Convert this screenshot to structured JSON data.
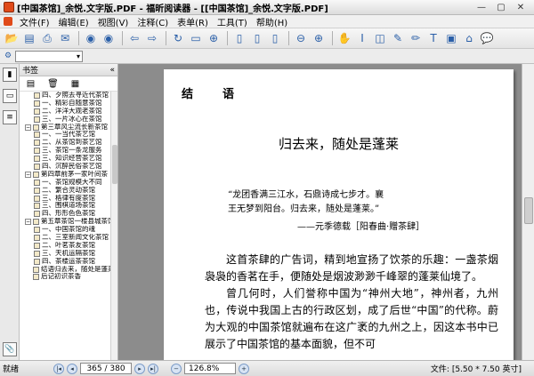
{
  "window": {
    "title": "[中国茶馆]_余悦.文字版.PDF - 福昕阅读器 - [[中国茶馆]_余悦.文字版.PDF]",
    "controls": [
      "minimize-icon",
      "maximize-icon",
      "close-icon"
    ]
  },
  "menu": {
    "items": [
      "文件(F)",
      "编辑(E)",
      "视图(V)",
      "注释(C)",
      "表单(R)",
      "工具(T)",
      "帮助(H)"
    ]
  },
  "toolbar": {
    "icons": [
      "open-icon",
      "save-icon",
      "print-icon",
      "email-icon",
      "nav-back-icon",
      "nav-forward-icon",
      "prev-view-icon",
      "next-view-icon",
      "rotate-icon",
      "zoom-in-icon",
      "page-single-icon",
      "page-continuous-icon",
      "page-facing-icon",
      "zoom-out-icon",
      "zoom-plus-icon",
      "hand-tool-icon",
      "select-icon",
      "snapshot-icon",
      "highlight-icon",
      "pencil-icon",
      "typewriter-icon",
      "note-icon",
      "stamp-icon",
      "comment-icon"
    ]
  },
  "sidebar": {
    "panel_title": "书签",
    "collapse_symbol": "«",
    "tabs": [
      "bookmarks-icon",
      "pages-icon",
      "layers-icon",
      "attachments-icon"
    ],
    "tree": [
      {
        "level": 2,
        "label": "四、夕照去寻近代茶馆"
      },
      {
        "level": 2,
        "label": "一、精彩自随意茶馆"
      },
      {
        "level": 2,
        "label": "二、洋洋大观老茶馆"
      },
      {
        "level": 2,
        "label": "三、一片冰心在茶馆"
      },
      {
        "level": 1,
        "label": "第三章风尘流长新茶馆",
        "toggle": "−"
      },
      {
        "level": 2,
        "label": "一、一当代茶艺馆"
      },
      {
        "level": 2,
        "label": "二、从茶馆到茶艺馆"
      },
      {
        "level": 2,
        "label": "三、茶馆一条龙服务"
      },
      {
        "level": 2,
        "label": "三、知识经营茶艺馆"
      },
      {
        "level": 2,
        "label": "四、沉醉民俗茶艺馆"
      },
      {
        "level": 1,
        "label": "第四章前茅一家叶间茶",
        "toggle": "−"
      },
      {
        "level": 2,
        "label": "一、茶馆规模大不同"
      },
      {
        "level": 2,
        "label": "二、繁合灵动茶馆"
      },
      {
        "level": 2,
        "label": "三、格律有度茶馆"
      },
      {
        "level": 2,
        "label": "三、围棋道场茶馆"
      },
      {
        "level": 2,
        "label": "四、形形色色茶馆"
      },
      {
        "level": 1,
        "label": "第五章茶馆一楼县城茶馆",
        "toggle": "−"
      },
      {
        "level": 2,
        "label": "一、中国茶馆的魂"
      },
      {
        "level": 2,
        "label": "二、三室新闻文化茶馆"
      },
      {
        "level": 2,
        "label": "二、叶茗茶友茶馆"
      },
      {
        "level": 2,
        "label": "三、天机运隔茶馆"
      },
      {
        "level": 2,
        "label": "四、茶楼运茶茶馆"
      },
      {
        "level": 1,
        "label": "结语归去来，随处是蓬莱"
      },
      {
        "level": 1,
        "label": "后记初识茶香"
      }
    ]
  },
  "document": {
    "chapter_label": "结　语",
    "heading": "归去来，随处是蓬莱",
    "quote_lines": [
      "“龙团香满三江水，石鼎诗成七步才。襄",
      "王无梦到阳台。归去来，随处是蓬莱。”"
    ],
    "attribution": "——元季德载［阳春曲·赠茶肆］",
    "paragraphs": [
      "这首茶肆的广告词，精到地宣扬了饮茶的乐趣：一盏茶烟袅袅的香茗在手，便随处是烟波渺渺千峰翠的蓬莱仙境了。",
      "曾几何时，人们誉称中国为“神州大地”，神州者，九州也，传说中我国上古的行政区划，成了后世“中国”的代称。蔚为大观的中国茶馆就遍布在这广袤的九州之上，因这本书中已展示了中国茶馆的基本面貌，但不可"
    ]
  },
  "status": {
    "left_text": "就绪",
    "page_display": "365 / 380",
    "zoom": "126.8%",
    "doc_size": "文件: [5.50 * 7.50 英寸]"
  },
  "colors": {
    "doc_background": "#8c8c8c",
    "app_icon": "#e04a1a",
    "toolbar_icon": "#2a5fa8"
  }
}
